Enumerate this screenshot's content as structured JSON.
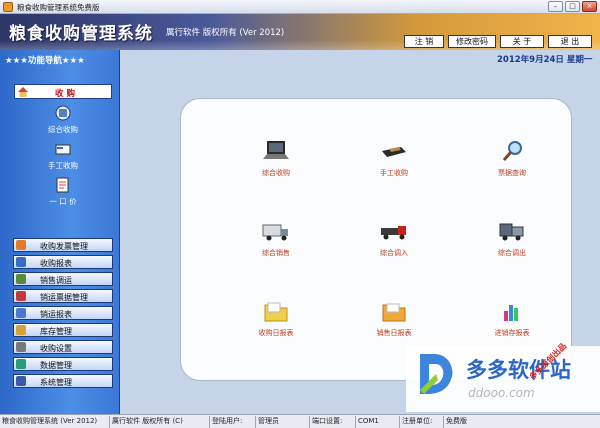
{
  "window": {
    "title": "粮食收购管理系统免费版",
    "buttons": {
      "minimize": "–",
      "maximize": "□",
      "close": "×"
    }
  },
  "banner": {
    "title": "粮食收购管理系统",
    "subtitle": "厲行软件 版权所有 (Ver 2012)"
  },
  "toolbar": {
    "logout": "注 销",
    "change_password": "修改密码",
    "about": "关 于",
    "exit": "退 出"
  },
  "date_text": "2012年9月24日  星期一",
  "sidebar": {
    "header": "★★★功能导航★★★",
    "active_section": "收 购",
    "sub_items": [
      {
        "label": "综合收购",
        "icon": "calculator-icon"
      },
      {
        "label": "手工收购",
        "icon": "card-icon"
      },
      {
        "label": "一 口 价",
        "icon": "note-icon"
      }
    ],
    "sections": [
      {
        "label": "收购发票管理",
        "icon": "invoice-icon"
      },
      {
        "label": "收购报表",
        "icon": "report-icon"
      },
      {
        "label": "销售调运",
        "icon": "truck-icon"
      },
      {
        "label": "销运票据管理",
        "icon": "receipt-icon"
      },
      {
        "label": "销运报表",
        "icon": "report-icon"
      },
      {
        "label": "库存管理",
        "icon": "warehouse-icon"
      },
      {
        "label": "收购设置",
        "icon": "settings-icon"
      },
      {
        "label": "数据管理",
        "icon": "database-icon"
      },
      {
        "label": "系统管理",
        "icon": "users-icon"
      }
    ]
  },
  "functions": [
    {
      "label": "综合收购",
      "icon": "laptop-icon"
    },
    {
      "label": "手工收购",
      "icon": "wallet-icon"
    },
    {
      "label": "票据查询",
      "icon": "magnifier-icon"
    },
    {
      "label": "综合销售",
      "icon": "truck-icon"
    },
    {
      "label": "综合调入",
      "icon": "red-truck-icon"
    },
    {
      "label": "综合调出",
      "icon": "cargo-truck-icon"
    },
    {
      "label": "收购日报表",
      "icon": "folder-icon"
    },
    {
      "label": "销售日报表",
      "icon": "folder-icon"
    },
    {
      "label": "进销存报表",
      "icon": "chart-icon"
    }
  ],
  "status_bar": {
    "app": "粮食收购管理系统 (Ver 2012)",
    "copyright": "厲行软件 版权所有 (C)",
    "user_label": "登陆用户:",
    "user_value": "管理员",
    "port_label": "端口设置:",
    "port_value": "COM1",
    "reg_label": "注册单位:",
    "reg_value": "免费版"
  },
  "watermark": {
    "name": "多多软件站",
    "url": "ddooo.com",
    "stamp": "多多原创出品"
  },
  "colors": {
    "sidebar_blue": "#3c78d6",
    "label_red": "#c23a1a",
    "active_red": "#c0141a"
  }
}
